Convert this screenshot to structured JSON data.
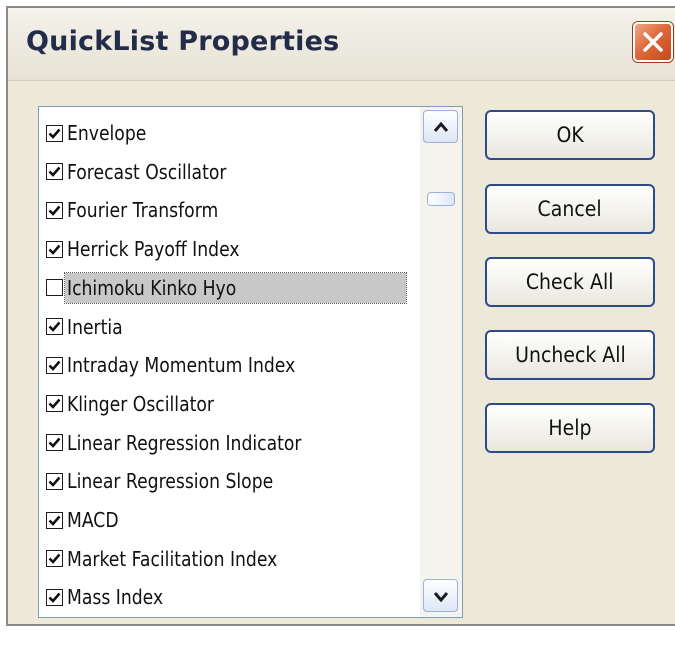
{
  "window": {
    "title": "QuickList Properties",
    "close_icon": "close-icon"
  },
  "list": {
    "items": [
      {
        "label": "Envelope",
        "checked": true
      },
      {
        "label": "Forecast Oscillator",
        "checked": true
      },
      {
        "label": "Fourier Transform",
        "checked": true
      },
      {
        "label": "Herrick Payoff Index",
        "checked": true
      },
      {
        "label": "Ichimoku Kinko Hyo",
        "checked": false,
        "selected": true
      },
      {
        "label": "Inertia",
        "checked": true
      },
      {
        "label": "Intraday Momentum Index",
        "checked": true
      },
      {
        "label": "Klinger Oscillator",
        "checked": true
      },
      {
        "label": "Linear Regression Indicator",
        "checked": true
      },
      {
        "label": "Linear Regression Slope",
        "checked": true
      },
      {
        "label": "MACD",
        "checked": true
      },
      {
        "label": "Market Facilitation Index",
        "checked": true
      },
      {
        "label": "Mass Index",
        "checked": true
      }
    ]
  },
  "buttons": {
    "ok": "OK",
    "cancel": "Cancel",
    "check_all": "Check All",
    "uncheck_all": "Uncheck All",
    "help": "Help"
  },
  "colors": {
    "dialog_bg": "#ece9d8",
    "title_text": "#232c48",
    "close_button": "#e06a3c",
    "button_border": "#2f4a8a"
  }
}
